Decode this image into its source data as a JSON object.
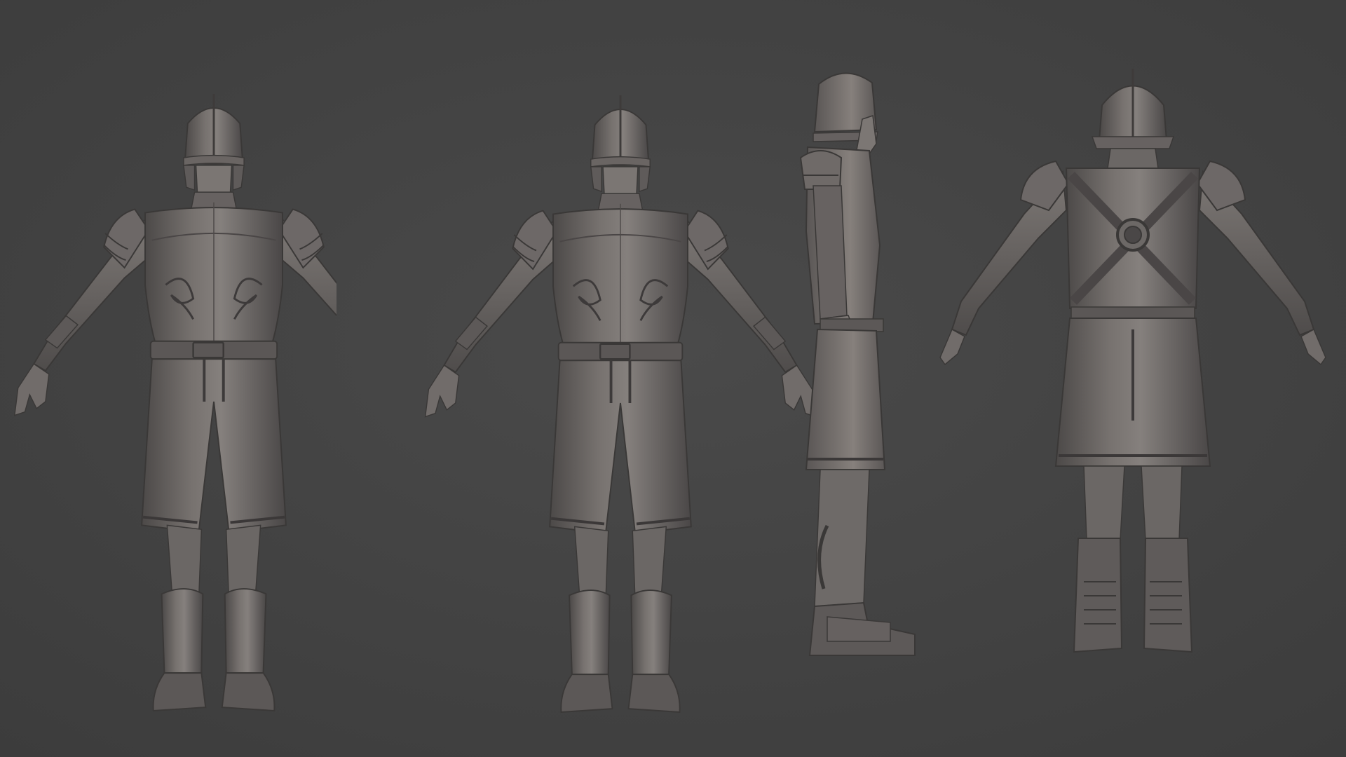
{
  "scene": {
    "description_free": true,
    "views": [
      {
        "id": "front",
        "label": ""
      },
      {
        "id": "three-quarter",
        "label": ""
      },
      {
        "id": "side",
        "label": ""
      },
      {
        "id": "back",
        "label": ""
      }
    ]
  },
  "colors": {
    "background": "#444444",
    "background_edge": "#3a3a3a",
    "clay_light": "#8a8684",
    "clay_mid": "#6e6a69",
    "clay_dark": "#4a4747",
    "clay_shadow": "#353333",
    "rim": "#a8a19d"
  }
}
